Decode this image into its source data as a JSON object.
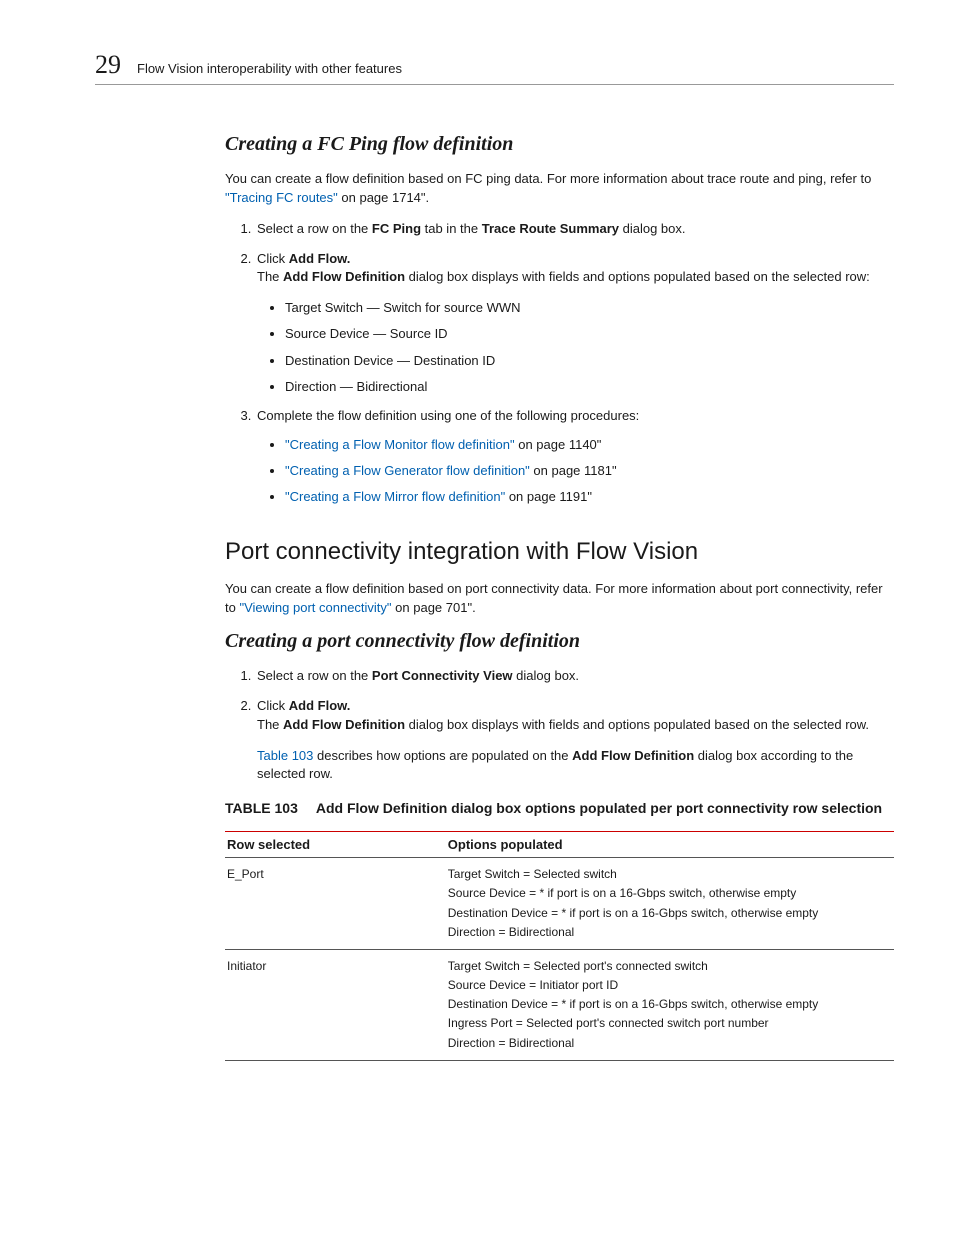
{
  "header": {
    "chapter_num": "29",
    "chapter_title": "Flow Vision interoperability with other features"
  },
  "section1": {
    "heading": "Creating a FC Ping flow definition",
    "intro_a": "You can create a flow definition based on FC ping data. For more information about trace route and ping, refer to ",
    "intro_link": "\"Tracing FC routes\"",
    "intro_b": " on page 1714\".",
    "step1_a": "Select a row on the ",
    "step1_b": "FC Ping",
    "step1_c": " tab in the ",
    "step1_d": "Trace Route Summary",
    "step1_e": " dialog box.",
    "step2_a": "Click ",
    "step2_b": "Add Flow.",
    "step2_desc_a": "The ",
    "step2_desc_b": "Add Flow Definition",
    "step2_desc_c": " dialog box displays with fields and options populated based on the selected row:",
    "bullets1": [
      "Target Switch — Switch for source WWN",
      "Source Device — Source ID",
      "Destination Device — Destination ID",
      "Direction — Bidirectional"
    ],
    "step3": "Complete the flow definition using one of the following procedures:",
    "links": [
      {
        "text": "\"Creating a Flow Monitor flow definition\"",
        "tail": " on page 1140\""
      },
      {
        "text": "\"Creating a Flow Generator flow definition\"",
        "tail": " on page 1181\""
      },
      {
        "text": "\"Creating a Flow Mirror flow definition\"",
        "tail": " on page 1191\""
      }
    ]
  },
  "section2": {
    "heading": "Port connectivity integration with Flow Vision",
    "intro_a": "You can create a flow definition based on port connectivity data. For more information about port connectivity, refer to ",
    "intro_link": "\"Viewing port connectivity\"",
    "intro_b": " on page 701\"."
  },
  "section3": {
    "heading": "Creating a port connectivity flow definition",
    "step1_a": "Select a row on the ",
    "step1_b": "Port Connectivity View",
    "step1_c": " dialog box.",
    "step2_a": "Click ",
    "step2_b": "Add Flow.",
    "desc1_a": "The ",
    "desc1_b": "Add Flow Definition",
    "desc1_c": " dialog box displays with fields and options populated based on the selected row.",
    "desc2_a": "Table 103",
    "desc2_b": " describes how options are populated on the ",
    "desc2_c": "Add Flow Definition",
    "desc2_d": " dialog box according to the selected row."
  },
  "table103": {
    "label": "TABLE 103",
    "title": "Add Flow Definition dialog box options populated per port connectivity row selection",
    "col1": "Row selected",
    "col2": "Options populated",
    "rows": [
      {
        "selected": "E_Port",
        "opts": "Target Switch = Selected switch\nSource Device = * if port is on a 16-Gbps switch, otherwise empty\nDestination Device = * if port is on a 16-Gbps switch, otherwise empty\nDirection = Bidirectional"
      },
      {
        "selected": "Initiator",
        "opts": "Target Switch = Selected port's connected switch\nSource Device = Initiator port ID\nDestination Device = * if port is on a 16-Gbps switch, otherwise empty\nIngress Port = Selected port's connected switch port number\nDirection = Bidirectional"
      }
    ]
  }
}
